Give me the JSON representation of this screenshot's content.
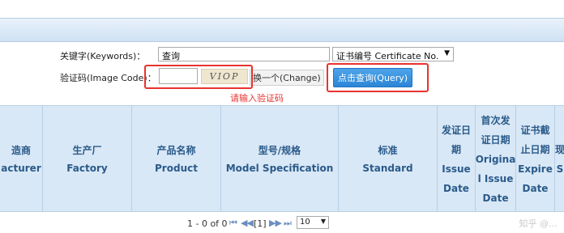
{
  "search": {
    "keywords_label": "关键字(Keywords)：",
    "keywords_value": "查询",
    "cert_select": "证书编号 Certificate No.",
    "image_code_label": "验证码(Image Code)：",
    "image_code_value": "",
    "captcha_text": "VIOP",
    "change_label": "换一个(Change)",
    "query_label": "点击查询(Query)",
    "hint": "请输入验证码"
  },
  "table": {
    "columns": [
      {
        "cn": "造商",
        "en": "acturer"
      },
      {
        "cn": "生产厂",
        "en": "Factory"
      },
      {
        "cn": "产品名称",
        "en": "Product"
      },
      {
        "cn": "型号/规格",
        "en": "Model Specification"
      },
      {
        "cn": "标准",
        "en": "Standard"
      },
      {
        "lines": [
          "发证日",
          "期",
          "Issue",
          "Date"
        ]
      },
      {
        "lines": [
          "首次发",
          "证日期",
          "Origina",
          "l Issue",
          "Date"
        ]
      },
      {
        "lines": [
          "证书截",
          "止日期",
          "Expire",
          "Date"
        ]
      },
      {
        "lines": [
          "现",
          "S"
        ]
      }
    ]
  },
  "pager": {
    "range": "1 - 0 of 0",
    "first": "⏮",
    "prev": "◀◀",
    "page": "[1]",
    "next": "▶▶",
    "last": "⏭",
    "page_size": "10"
  },
  "watermark": "知乎 @…"
}
